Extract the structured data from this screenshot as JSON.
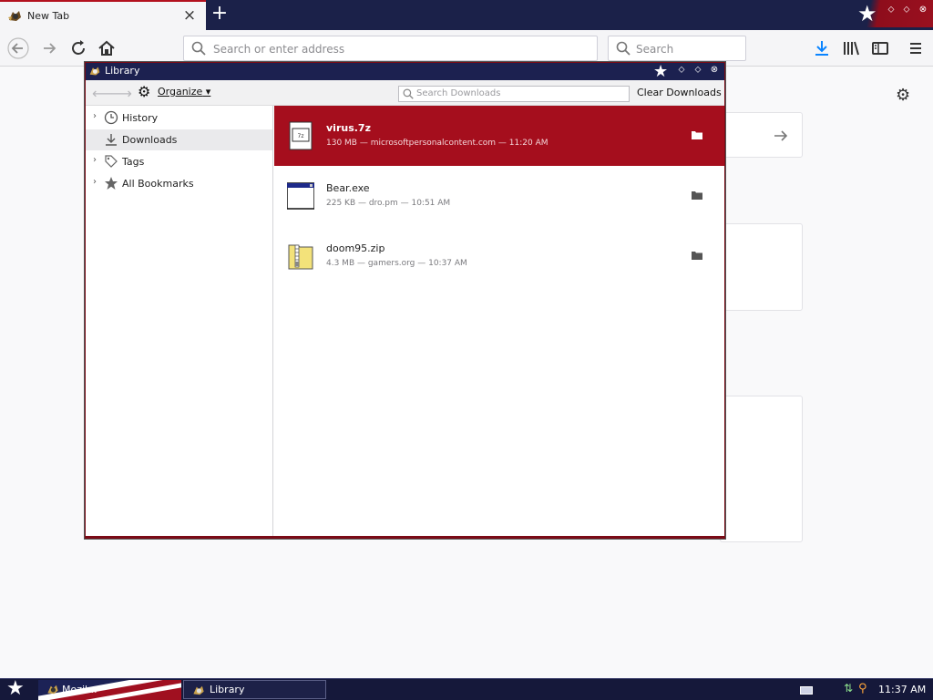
{
  "browser": {
    "tab_title": "New Tab",
    "tab_close": "×",
    "new_tab": "+",
    "url_placeholder": "Search or enter address",
    "search_placeholder": "Search",
    "window_controls": [
      "⬦",
      "⬦",
      "⊗"
    ]
  },
  "library": {
    "title": "Library",
    "organize_label": "Organize",
    "search_placeholder": "Search Downloads",
    "clear_label": "Clear Downloads",
    "sidebar": [
      {
        "label": "History",
        "twisty": "›",
        "icon": "clock-icon"
      },
      {
        "label": "Downloads",
        "twisty": "",
        "icon": "download-icon",
        "selected": true
      },
      {
        "label": "Tags",
        "twisty": "›",
        "icon": "tag-icon"
      },
      {
        "label": "All Bookmarks",
        "twisty": "›",
        "icon": "star-icon"
      }
    ],
    "downloads": [
      {
        "name": "virus.7z",
        "meta": "130 MB — microsoftpersonalcontent.com — 11:20 AM",
        "icon": "archive-file-icon",
        "selected": true
      },
      {
        "name": "Bear.exe",
        "meta": "225 KB — dro.pm — 10:51 AM",
        "icon": "executable-file-icon",
        "selected": false
      },
      {
        "name": "doom95.zip",
        "meta": "4.3 MB — gamers.org — 10:37 AM",
        "icon": "zip-file-icon",
        "selected": false
      }
    ]
  },
  "taskbar": {
    "items": [
      {
        "label": "Mozil..."
      },
      {
        "label": "Library"
      }
    ],
    "clock": "11:37 AM"
  },
  "colors": {
    "accent_red": "#a50e1d",
    "navy": "#1b2149"
  }
}
